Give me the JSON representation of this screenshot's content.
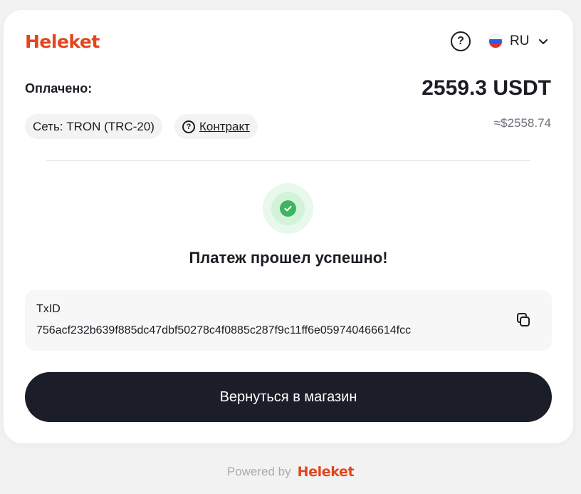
{
  "brand": {
    "name": "Heleket",
    "color": "#e2461c"
  },
  "header": {
    "help_icon": "question-circle-icon",
    "language": {
      "code": "RU",
      "flag_icon": "russia-flag-icon",
      "chevron_icon": "chevron-down-icon"
    }
  },
  "payment": {
    "paid_label": "Оплачено:",
    "amount": "2559.3 USDT",
    "usd_equivalent": "≈$2558.74",
    "network_chip": "Сеть: TRON (TRC-20)",
    "contract_chip": "Контракт"
  },
  "status": {
    "icon": "check-circle-icon",
    "title": "Платеж прошел успешно!",
    "success_color": "#3eb45e"
  },
  "transaction": {
    "label": "TxID",
    "value": "756acf232b639f885dc47dbf50278c4f0885c287f9c11ff6e059740466614fcc",
    "copy_icon": "copy-icon"
  },
  "actions": {
    "return_label": "Вернуться в магазин"
  },
  "footer": {
    "powered_by": "Powered by",
    "brand": "Heleket"
  }
}
